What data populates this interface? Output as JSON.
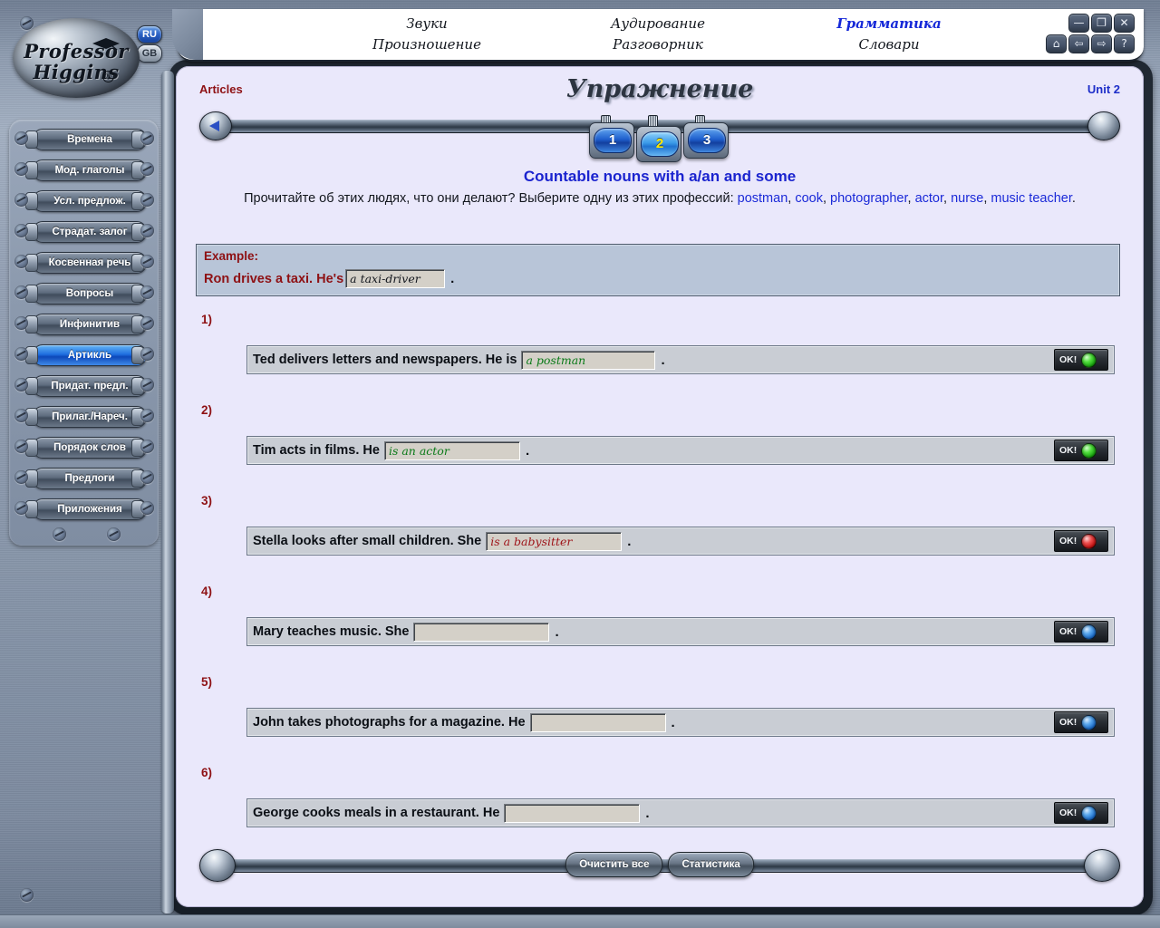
{
  "app": {
    "logo_line1": "Professor",
    "logo_line2": "Higgins",
    "registered_mark": "®"
  },
  "lang": {
    "ru": "RU",
    "gb": "GB"
  },
  "menu": {
    "items": [
      {
        "label": "Звуки",
        "active": false
      },
      {
        "label": "Аудирование",
        "active": false
      },
      {
        "label": "Грамматика",
        "active": true
      },
      {
        "label": "Произношение",
        "active": false
      },
      {
        "label": "Разговорник",
        "active": false
      },
      {
        "label": "Словари",
        "active": false
      }
    ]
  },
  "window_controls": {
    "minimize": "—",
    "restore": "❐",
    "close": "✕",
    "home": "⌂",
    "back": "⇦",
    "forward": "⇨",
    "help": "?"
  },
  "sidebar": {
    "items": [
      {
        "label": "Времена",
        "selected": false
      },
      {
        "label": "Мод. глаголы",
        "selected": false
      },
      {
        "label": "Усл. предлож.",
        "selected": false
      },
      {
        "label": "Страдат. залог",
        "selected": false
      },
      {
        "label": "Косвенная речь",
        "selected": false
      },
      {
        "label": "Вопросы",
        "selected": false
      },
      {
        "label": "Инфинитив",
        "selected": false
      },
      {
        "label": "Артикль",
        "selected": true
      },
      {
        "label": "Придат. предл.",
        "selected": false
      },
      {
        "label": "Прилаг./Нареч.",
        "selected": false
      },
      {
        "label": "Порядок слов",
        "selected": false
      },
      {
        "label": "Предлоги",
        "selected": false
      },
      {
        "label": "Приложения",
        "selected": false
      }
    ]
  },
  "header": {
    "section": "Articles",
    "title": "Упражнение",
    "unit": "Unit 2"
  },
  "pagination": {
    "tabs": [
      {
        "label": "1",
        "current": false
      },
      {
        "label": "2",
        "current": true
      },
      {
        "label": "3",
        "current": false
      }
    ]
  },
  "exercise": {
    "title": "Countable nouns with a/an and some",
    "instruction_prefix": "Прочитайте об этих людях, что они делают? Выберите одну из этих профессий: ",
    "professions": [
      "postman",
      "cook",
      "photographer",
      "actor",
      "nurse",
      "music teacher"
    ],
    "instruction_end": ".",
    "example": {
      "label": "Example:",
      "before": "Ron drives a taxi. He's",
      "answer": "a taxi-driver",
      "after": "."
    },
    "ok_label": "OK!",
    "items": [
      {
        "number": "1)",
        "before": "Ted delivers letters and newspapers. He is",
        "answer": "a postman",
        "field_width": 138,
        "after": ".",
        "status": "green"
      },
      {
        "number": "2)",
        "before": "Tim acts in films. He",
        "answer": "is an actor",
        "field_width": 140,
        "after": ".",
        "status": "green"
      },
      {
        "number": "3)",
        "before": "Stella looks after small children. She",
        "answer": "is a babysitter",
        "field_width": 140,
        "after": ".",
        "status": "red"
      },
      {
        "number": "4)",
        "before": "Mary teaches music. She",
        "answer": "",
        "field_width": 140,
        "after": ".",
        "status": "blue"
      },
      {
        "number": "5)",
        "before": "John takes photographs for a magazine. He",
        "answer": "",
        "field_width": 140,
        "after": ".",
        "status": "blue"
      },
      {
        "number": "6)",
        "before": "George cooks meals in a restaurant. He",
        "answer": "",
        "field_width": 140,
        "after": ".",
        "status": "blue"
      }
    ]
  },
  "footer": {
    "clear_all": "Очистить все",
    "statistics": "Статистика"
  },
  "colors": {
    "accent_blue": "#1b24cf",
    "dark_red": "#8e1114",
    "correct_green": "#0a7a18",
    "wrong_red": "#9e1217",
    "panel_bg": "#eae8fb"
  }
}
